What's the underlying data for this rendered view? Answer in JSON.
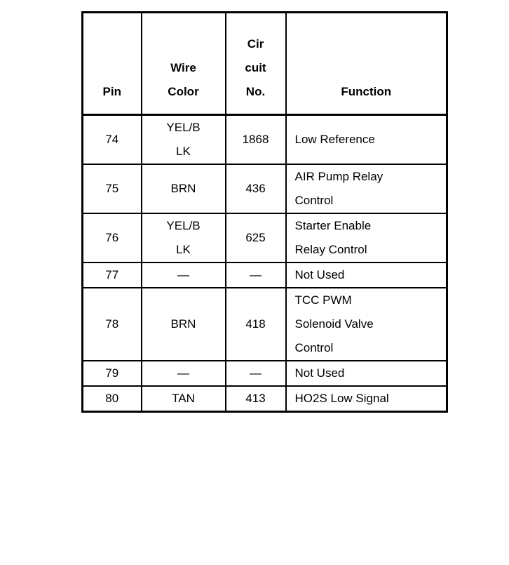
{
  "document": {
    "type": "wiring-pinout-table",
    "page_background": "#ffffff",
    "ink_color": "#000000"
  },
  "table": {
    "columns": [
      {
        "key": "pin",
        "header_lines": [
          "Pin"
        ],
        "align": "center"
      },
      {
        "key": "wire",
        "header_lines": [
          "Wire",
          "Color"
        ],
        "align": "center"
      },
      {
        "key": "circuit",
        "header_lines": [
          "Cir",
          "cuit",
          "No."
        ],
        "align": "center"
      },
      {
        "key": "function",
        "header_lines": [
          "Function"
        ],
        "align": "left"
      }
    ],
    "rows": [
      {
        "pin": "74",
        "wire_lines": [
          "YEL/B",
          "LK"
        ],
        "circuit": "1868",
        "function_lines": [
          "Low Reference"
        ]
      },
      {
        "pin": "75",
        "wire_lines": [
          "BRN"
        ],
        "circuit": "436",
        "function_lines": [
          "AIR Pump Relay",
          "Control"
        ]
      },
      {
        "pin": "76",
        "wire_lines": [
          "YEL/B",
          "LK"
        ],
        "circuit": "625",
        "function_lines": [
          "Starter Enable",
          "Relay Control"
        ]
      },
      {
        "pin": "77",
        "wire_lines": [
          "—"
        ],
        "circuit": "—",
        "function_lines": [
          "Not Used"
        ]
      },
      {
        "pin": "78",
        "wire_lines": [
          "BRN"
        ],
        "circuit": "418",
        "function_lines": [
          "TCC PWM",
          "Solenoid Valve",
          "Control"
        ]
      },
      {
        "pin": "79",
        "wire_lines": [
          "—"
        ],
        "circuit": "—",
        "function_lines": [
          "Not Used"
        ]
      },
      {
        "pin": "80",
        "wire_lines": [
          "TAN"
        ],
        "circuit": "413",
        "function_lines": [
          "HO2S Low Signal"
        ]
      }
    ]
  }
}
